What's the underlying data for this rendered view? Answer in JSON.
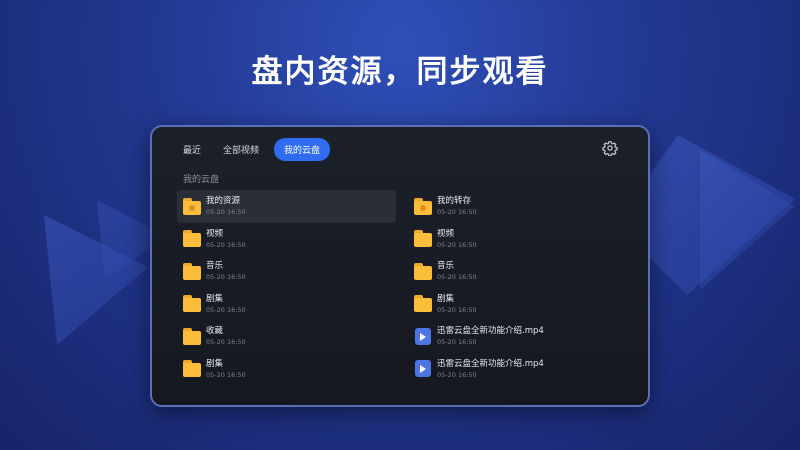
{
  "headline": "盘内资源，同步观看",
  "tabs": [
    {
      "label": "最近",
      "active": false
    },
    {
      "label": "全部视频",
      "active": false
    },
    {
      "label": "我的云盘",
      "active": true
    }
  ],
  "settings_icon": "gear-icon",
  "section_label": "我的云盘",
  "colors": {
    "accent": "#2f6cf0",
    "folder": "#fbbd3a",
    "video": "#4e74e8"
  },
  "left_items": [
    {
      "name": "我的资源",
      "date": "05-20  16:50",
      "icon": "folder-icon"
    },
    {
      "name": "视频",
      "date": "05-20  16:50",
      "icon": "folder-icon"
    },
    {
      "name": "音乐",
      "date": "05-20  16:50",
      "icon": "folder-icon"
    },
    {
      "name": "剧集",
      "date": "05-20  16:50",
      "icon": "folder-icon"
    },
    {
      "name": "收藏",
      "date": "05-20  16:50",
      "icon": "folder-icon"
    },
    {
      "name": "剧集",
      "date": "05-20  16:50",
      "icon": "folder-icon"
    }
  ],
  "right_items": [
    {
      "name": "我的转存",
      "date": "05-20  16:50",
      "icon": "folder-icon"
    },
    {
      "name": "视频",
      "date": "05-20  16:50",
      "icon": "folder-icon"
    },
    {
      "name": "音乐",
      "date": "05-20  16:50",
      "icon": "folder-icon"
    },
    {
      "name": "剧集",
      "date": "05-20  16:50",
      "icon": "folder-icon"
    },
    {
      "name": "迅雷云盘全新功能介绍.mp4",
      "date": "05-20  16:50",
      "icon": "video-file-icon"
    },
    {
      "name": "迅雷云盘全新功能介绍.mp4",
      "date": "05-20  16:50",
      "icon": "video-file-icon"
    }
  ]
}
